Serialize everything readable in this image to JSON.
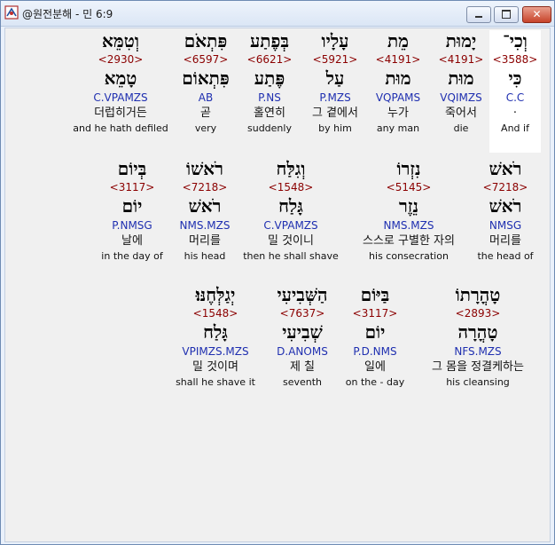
{
  "window": {
    "title": "@원전분해 - 민 6:9",
    "minimize_glyph": "—",
    "maximize_glyph": "☐",
    "close_glyph": "✕"
  },
  "rows": [
    [
      {
        "hebrew": "וְכִי־",
        "strongs": "<3588>",
        "lemma": "כִּי",
        "morph": "C.C",
        "korean": "",
        "english": "And if",
        "highlight": true
      },
      {
        "hebrew": "יָמוּת",
        "strongs": "<4191>",
        "lemma": "מוּת",
        "morph": "VQIMZS",
        "korean": "죽어서",
        "english": "die"
      },
      {
        "hebrew": "מֵת",
        "strongs": "<4191>",
        "lemma": "מוּת",
        "morph": "VQPAMS",
        "korean": "누가",
        "english": "any man"
      },
      {
        "hebrew": "עָלָיו",
        "strongs": "<5921>",
        "lemma": "עַל",
        "morph": "P.MZS",
        "korean": "그 곁에서",
        "english": "by him"
      },
      {
        "hebrew": "בְּפֶתַע",
        "strongs": "<6621>",
        "lemma": "פֶּתַע",
        "morph": "P.NS",
        "korean": "홀연히",
        "english": "suddenly"
      },
      {
        "hebrew": "פִּתְאֹם",
        "strongs": "<6597>",
        "lemma": "פִּתְאוֹם",
        "morph": "AB",
        "korean": "곧",
        "english": "very"
      },
      {
        "hebrew": "וְטִמֵּא",
        "strongs": "<2930>",
        "lemma": "טָמֵא",
        "morph": "C.VPAMZS",
        "korean": "더럽히거든",
        "english": "and he hath defiled"
      }
    ],
    [
      {
        "hebrew": "רֹאשׁ",
        "strongs": "<7218>",
        "lemma": "רֹאשׁ",
        "morph": "NMSG",
        "korean": "머리를",
        "english": "the head of"
      },
      {
        "hebrew": "נִזְרוֹ",
        "strongs": "<5145>",
        "lemma": "נֵזֶר",
        "morph": "NMS.MZS",
        "korean": "스스로 구별한 자의",
        "english": "his consecration"
      },
      {
        "hebrew": "וְגִלַּח",
        "strongs": "<1548>",
        "lemma": "גָּלַח",
        "morph": "C.VPAMZS",
        "korean": "밀 것이니",
        "english": "then he shall shave"
      },
      {
        "hebrew": "רֹאשׁוֹ",
        "strongs": "<7218>",
        "lemma": "רֹאשׁ",
        "morph": "NMS.MZS",
        "korean": "머리를",
        "english": "his head"
      },
      {
        "hebrew": "בְּיוֹם",
        "strongs": "<3117>",
        "lemma": "יוֹם",
        "morph": "P.NMSG",
        "korean": "날에",
        "english": "in the day of"
      }
    ],
    [
      {
        "hebrew": "טָהֳרָתוֹ",
        "strongs": "<2893>",
        "lemma": "טָהֳרָה",
        "morph": "NFS.MZS",
        "korean": "그 몸을 정결케하는",
        "english": "his cleansing"
      },
      {
        "hebrew": "בַּיּוֹם",
        "strongs": "<3117>",
        "lemma": "יוֹם",
        "morph": "P.D.NMS",
        "korean": "일에",
        "english": "on the - day"
      },
      {
        "hebrew": "הַשְּׁבִיעִי",
        "strongs": "<7637>",
        "lemma": "שְׁבִיעִי",
        "morph": "D.ANOMS",
        "korean": "제 칠",
        "english": "seventh"
      },
      {
        "hebrew": "יְגַלְּחֶנּוּ׃",
        "strongs": "<1548>",
        "lemma": "גָּלַח",
        "morph": "VPIMZS.MZS",
        "korean": "밀 것이며",
        "english": "shall he shave it"
      }
    ]
  ]
}
